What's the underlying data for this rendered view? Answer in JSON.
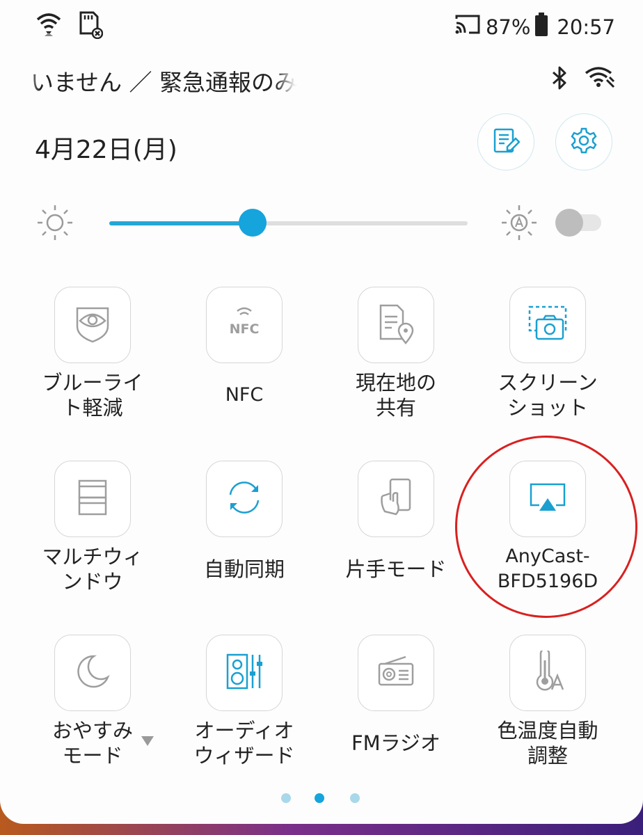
{
  "status_bar": {
    "battery_percent": "87%",
    "time": "20:57",
    "icons": [
      "wifi-icon",
      "sd-card-error-icon",
      "cast-icon",
      "battery-icon"
    ]
  },
  "carrier": {
    "text": "いません ／ 緊急通報のみ",
    "icons": [
      "bluetooth-icon",
      "wifi-settings-icon"
    ]
  },
  "header": {
    "date": "4月22日(月)",
    "buttons": [
      "edit-tiles-icon",
      "settings-icon"
    ]
  },
  "brightness": {
    "level": 0.4,
    "auto": false,
    "icons": [
      "brightness-icon",
      "auto-brightness-icon"
    ]
  },
  "tiles": [
    {
      "label": "ブルーライ\nト軽減",
      "icon": "eye-shield-icon",
      "active": false
    },
    {
      "label": "NFC",
      "icon": "nfc-icon",
      "active": false
    },
    {
      "label": "現在地の\n共有",
      "icon": "location-share-icon",
      "active": false
    },
    {
      "label": "スクリーン\nショット",
      "icon": "screenshot-icon",
      "active": true
    },
    {
      "label": "マルチウィ\nンドウ",
      "icon": "multiwindow-icon",
      "active": false
    },
    {
      "label": "自動同期",
      "icon": "sync-icon",
      "active": true
    },
    {
      "label": "片手モード",
      "icon": "one-hand-icon",
      "active": false
    },
    {
      "label": "AnyCast-\nBFD5196D",
      "icon": "anycast-icon",
      "active": true
    },
    {
      "label": "おやすみ\nモード",
      "icon": "moon-icon",
      "active": false
    },
    {
      "label": "オーディオ\nウィザード",
      "icon": "audio-wizard-icon",
      "active": true
    },
    {
      "label": "FMラジオ",
      "icon": "radio-icon",
      "active": false
    },
    {
      "label": "色温度自動\n調整",
      "icon": "color-temp-icon",
      "active": false
    }
  ],
  "pager": {
    "current": 2,
    "total": 3
  },
  "colors": {
    "accent": "#16a4dc",
    "inactive_icon": "#9e9e9e",
    "annotation": "#d92020"
  }
}
